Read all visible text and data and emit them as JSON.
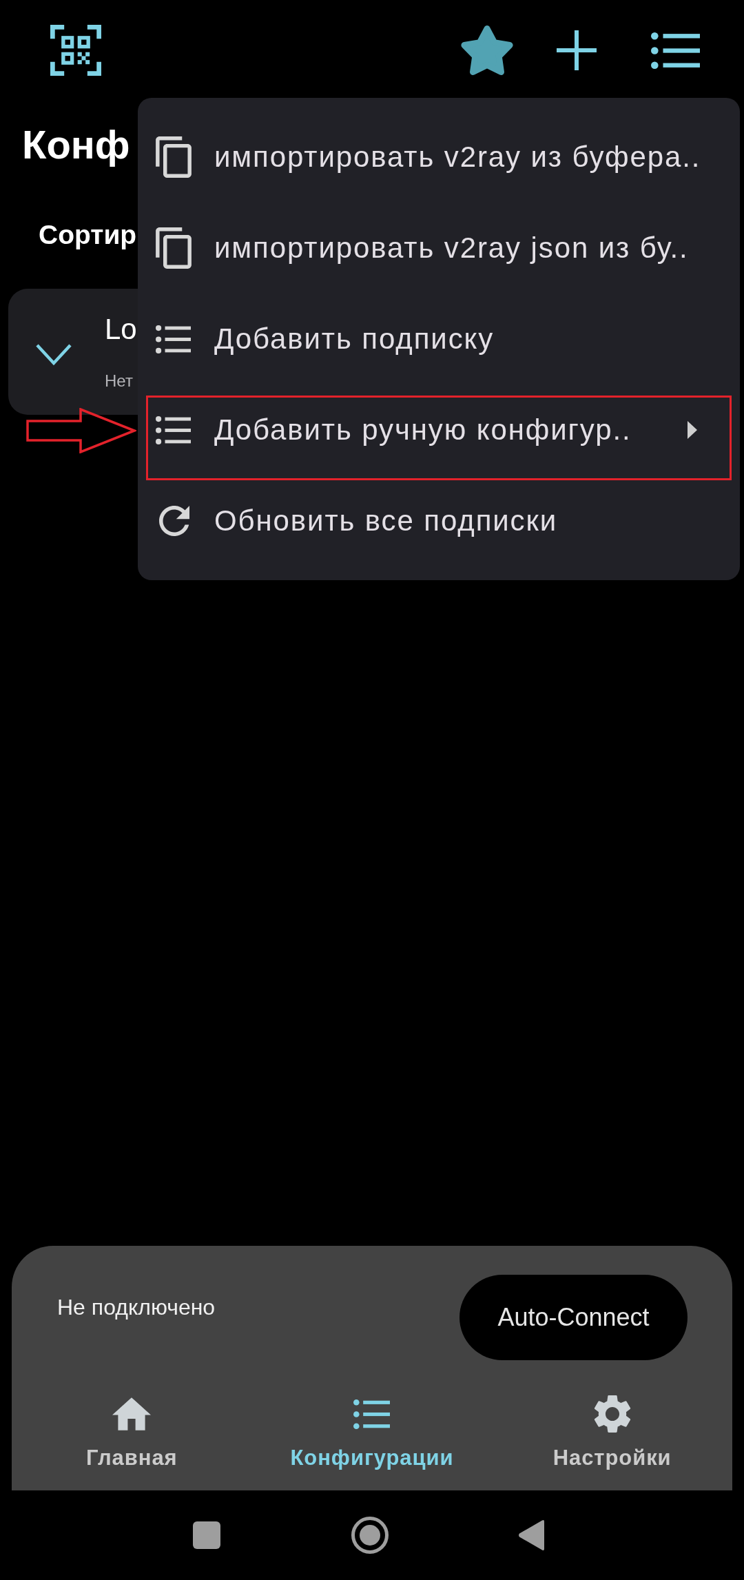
{
  "title": "Конф",
  "sort_label": "Сортир",
  "config_card": {
    "name": "Lo",
    "subtitle": "Нет"
  },
  "menu": {
    "items": [
      {
        "kind": "copy",
        "label": "импортировать v2ray из буфера..",
        "submenu": false,
        "annotated": false
      },
      {
        "kind": "copy",
        "label": "импортировать v2ray json из бу..",
        "submenu": false,
        "annotated": false
      },
      {
        "kind": "list",
        "label": "Добавить подписку",
        "submenu": false,
        "annotated": false
      },
      {
        "kind": "list",
        "label": "Добавить ручную конфигур..",
        "submenu": true,
        "annotated": true
      },
      {
        "kind": "refresh",
        "label": "Обновить все подписки",
        "submenu": false,
        "annotated": false
      }
    ]
  },
  "status_panel": {
    "status": "Не подключено",
    "connect_button": "Auto-Connect"
  },
  "bottom_nav": [
    {
      "kind": "home",
      "label": "Главная",
      "selected": false
    },
    {
      "kind": "list",
      "label": "Конфигурации",
      "selected": true
    },
    {
      "kind": "settings",
      "label": "Настройки",
      "selected": false
    }
  ]
}
